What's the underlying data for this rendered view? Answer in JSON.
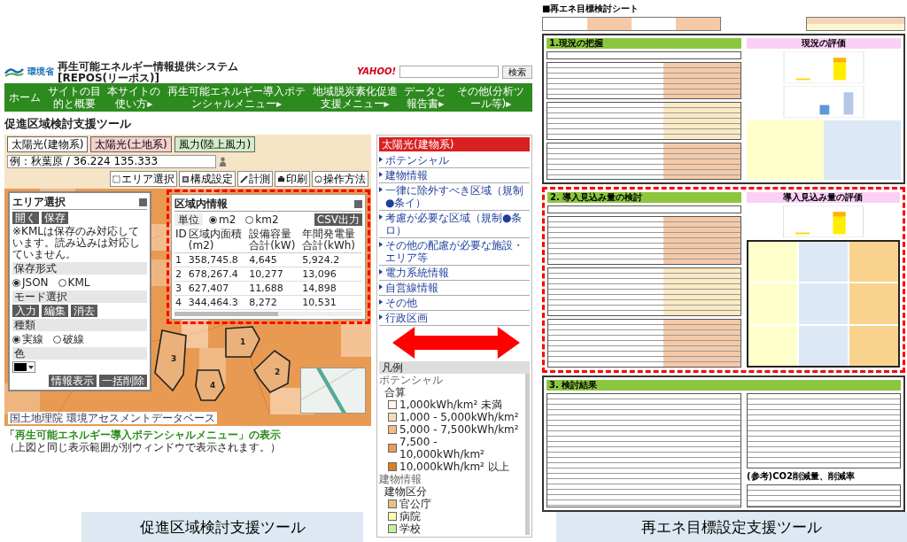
{
  "left_screen": {
    "header": {
      "ministry": "環境省",
      "title": "再生可能エネルギー情報提供システム",
      "subtitle": "[REPOS(リーポス)]",
      "partner_logo": "YAHOO!",
      "search_button": "検索"
    },
    "nav": [
      {
        "label": "ホーム"
      },
      {
        "label": "サイトの目的と概要"
      },
      {
        "label": "本サイトの使い方▸"
      },
      {
        "label": "再生可能エネルギー導入ポテンシャルメニュー▸"
      },
      {
        "label": "地域脱炭素化促進支援メニュー▸"
      },
      {
        "label": "データと報告書▸"
      },
      {
        "label": "その他(分析ツール等)▸"
      }
    ],
    "page_title": "促進区域検討支援ツール",
    "tool_tabs": [
      {
        "label": "太陽光(建物系)",
        "color": "#ffffff"
      },
      {
        "label": "太陽光(土地系)",
        "color": "#f6cfcf"
      },
      {
        "label": "風力(陸上風力)",
        "color": "#d3edc9"
      }
    ],
    "location_field": {
      "value": "例：秋葉原 / 36.224 135.333"
    },
    "map_tools": [
      {
        "kind": "area",
        "label": "エリア選択"
      },
      {
        "kind": "layers",
        "label": "構成設定"
      },
      {
        "kind": "measure",
        "label": "計測"
      },
      {
        "kind": "print",
        "label": "印刷"
      },
      {
        "kind": "help",
        "label": "操作方法"
      }
    ],
    "area_panel": {
      "title": "エリア選択",
      "file_buttons": [
        "開く",
        "保存"
      ],
      "note": "※KMLは保存のみ対応しています。読み込みは対応していません。",
      "save_format": {
        "label": "保存形式",
        "options": [
          {
            "label": "JSON",
            "selected": true
          },
          {
            "label": "KML",
            "selected": false
          }
        ]
      },
      "mode": {
        "label": "モード選択",
        "buttons": [
          "入力",
          "編集",
          "消去"
        ]
      },
      "line_type": {
        "label": "種類",
        "options": [
          {
            "label": "実線",
            "selected": true
          },
          {
            "label": "破線",
            "selected": false
          }
        ]
      },
      "color": {
        "label": "色",
        "color": "#000000"
      },
      "action_buttons": [
        "情報表示",
        "一括削除"
      ]
    },
    "areas": [
      {
        "label": "1"
      },
      {
        "label": "2"
      },
      {
        "label": "3"
      },
      {
        "label": "4"
      }
    ],
    "info_popup": {
      "title": "区域内情報",
      "unit_label": "単位",
      "units": [
        {
          "label": "m2",
          "selected": true
        },
        {
          "label": "km2",
          "selected": false
        }
      ],
      "export_button": "CSV出力",
      "columns": [
        "ID",
        "区域内面積(m2)",
        "設備容量合計(kW)",
        "年間発電量合計(kWh)"
      ],
      "rows": [
        [
          "1",
          "358,745.8",
          "4,645",
          "5,924.2"
        ],
        [
          "2",
          "678,267.4",
          "10,277",
          "13,096"
        ],
        [
          "3",
          "627,407",
          "11,688",
          "14,898"
        ],
        [
          "4",
          "344,464.3",
          "8,272",
          "10,531"
        ]
      ]
    },
    "map_attribution": "国土地理院 環境アセスメントデータベース",
    "sidebar": {
      "header": "太陽光(建物系)",
      "items": [
        {
          "label": "ポテンシャル"
        },
        {
          "label": "建物情報"
        },
        {
          "label": "一律に除外すべき区域（規制●条イ）"
        },
        {
          "label": "考慮が必要な区域（規制●条ロ）"
        },
        {
          "label": "その他の配慮が必要な施設・エリア等"
        },
        {
          "label": "電力系統情報"
        },
        {
          "label": "自営線情報"
        },
        {
          "label": "その他"
        },
        {
          "label": "行政区画"
        }
      ],
      "legend_title": "凡例",
      "legend": [
        {
          "kind": "group",
          "label": "ポテンシャル"
        },
        {
          "kind": "subgroup",
          "label": "合算"
        },
        {
          "kind": "swatch",
          "label": "1,000kWh/km² 未満",
          "color": "#fdf5ea"
        },
        {
          "kind": "swatch",
          "label": "1,000 - 5,000kWh/km²",
          "color": "#f8dcb8"
        },
        {
          "kind": "swatch",
          "label": "5,000 - 7,500kWh/km²",
          "color": "#f2bc84"
        },
        {
          "kind": "swatch",
          "label": "7,500 - 10,000kWh/km²",
          "color": "#eb9c52"
        },
        {
          "kind": "swatch",
          "label": "10,000kWh/km² 以上",
          "color": "#dc7f22"
        },
        {
          "kind": "group",
          "label": "建物情報"
        },
        {
          "kind": "subgroup",
          "label": "建物区分"
        },
        {
          "kind": "swatch",
          "label": "官公庁",
          "color": "#e6c47e"
        },
        {
          "kind": "swatch",
          "label": "病院",
          "color": "#fdfdb0"
        },
        {
          "kind": "swatch",
          "label": "学校",
          "color": "#c6ee9e"
        }
      ]
    },
    "bottom_link": "「再生可能エネルギー導入ポテンシャルメニュー」の表示",
    "bottom_note": "（上図と同じ表示範囲が別ウィンドウで表示されます。）"
  },
  "right_screen": {
    "title": "■再エネ目標検討シート",
    "sections": [
      {
        "kind": "status",
        "heading": "1.現況の把握",
        "evaluation_heading": "現況の評価",
        "highlighted": false
      },
      {
        "kind": "estimate",
        "heading": "2. 導入見込み量の検討",
        "evaluation_heading": "導入見込み量の評価",
        "highlighted": true
      },
      {
        "kind": "result",
        "heading": "3. 検討結果",
        "evaluation_heading": "(参考)CO2削減量、削減率",
        "highlighted": false
      }
    ]
  },
  "captions": [
    "促進区域検討支援ツール",
    "再エネ目標設定支援ツール"
  ]
}
